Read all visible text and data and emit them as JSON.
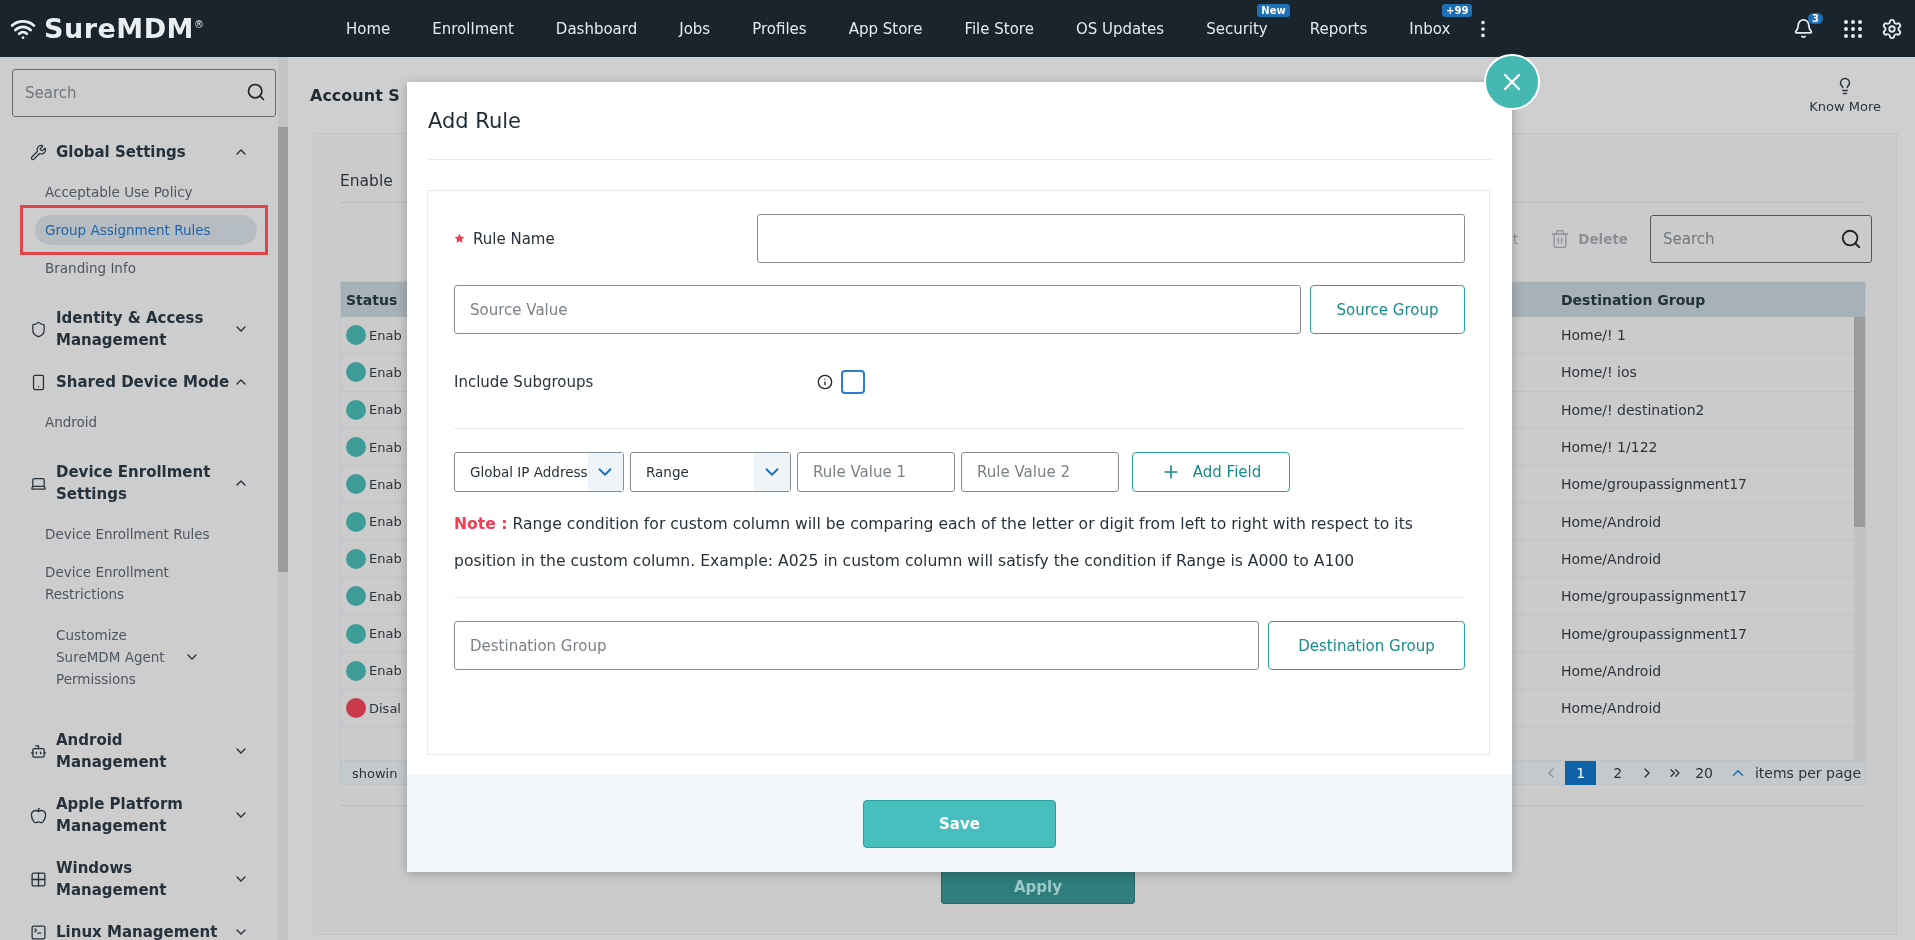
{
  "nav": {
    "logo": "SureMDM",
    "logo_mark": "®",
    "items": [
      {
        "label": "Home"
      },
      {
        "label": "Enrollment"
      },
      {
        "label": "Dashboard"
      },
      {
        "label": "Jobs"
      },
      {
        "label": "Profiles"
      },
      {
        "label": "App Store"
      },
      {
        "label": "File Store"
      },
      {
        "label": "OS Updates"
      },
      {
        "label": "Security",
        "badge": "New"
      },
      {
        "label": "Reports"
      },
      {
        "label": "Inbox",
        "badge": "+99"
      }
    ],
    "notifications_badge": "3"
  },
  "sidebar": {
    "search_placeholder": "Search",
    "sections": [
      {
        "title": "Global Settings",
        "expanded": true,
        "children": [
          {
            "kind": "link",
            "label": "Acceptable Use Policy",
            "selected": false,
            "highlighted": false
          },
          {
            "kind": "link",
            "label": "Group Assignment Rules",
            "selected": true,
            "highlighted": true
          },
          {
            "kind": "link",
            "label": "Branding Info",
            "selected": false,
            "highlighted": false
          }
        ]
      },
      {
        "title": "Identity & Access Management",
        "expanded": false
      },
      {
        "title": "Shared Device Mode",
        "expanded": true,
        "children": [
          {
            "kind": "link",
            "label": "Android",
            "selected": false,
            "highlighted": false
          }
        ]
      },
      {
        "title": "Device Enrollment Settings",
        "expanded": true,
        "children": [
          {
            "kind": "link",
            "label": "Device Enrollment Rules",
            "selected": false,
            "highlighted": false
          },
          {
            "kind": "link",
            "label": "Device Enrollment Restrictions",
            "selected": false,
            "highlighted": false
          },
          {
            "kind": "group",
            "label": "Customize SureMDM Agent Permissions",
            "selected": false,
            "highlighted": false,
            "expanded": false
          }
        ]
      },
      {
        "title": "Android Management",
        "expanded": false
      },
      {
        "title": "Apple Platform Management",
        "expanded": false
      },
      {
        "title": "Windows Management",
        "expanded": false
      },
      {
        "title": "Linux Management",
        "expanded": false
      }
    ]
  },
  "page": {
    "title": "Account S",
    "know_more": "Know More",
    "panel_label": "Enable",
    "toolbar": {
      "action_fragment": "t",
      "delete": "Delete",
      "search_placeholder": "Search"
    },
    "table": {
      "columns": [
        "Status",
        "Destination Group"
      ],
      "rows": [
        {
          "status": "Enab",
          "enabled": true,
          "destination": "Home/! 1"
        },
        {
          "status": "Enab",
          "enabled": true,
          "destination": "Home/! ios"
        },
        {
          "status": "Enab",
          "enabled": true,
          "destination": "Home/! destination2"
        },
        {
          "status": "Enab",
          "enabled": true,
          "destination": "Home/! 1/122"
        },
        {
          "status": "Enab",
          "enabled": true,
          "destination": "Home/groupassignment17"
        },
        {
          "status": "Enab",
          "enabled": true,
          "destination": "Home/Android"
        },
        {
          "status": "Enab",
          "enabled": true,
          "destination": "Home/Android"
        },
        {
          "status": "Enab",
          "enabled": true,
          "destination": "Home/groupassignment17"
        },
        {
          "status": "Enab",
          "enabled": true,
          "destination": "Home/groupassignment17"
        },
        {
          "status": "Enab",
          "enabled": true,
          "destination": "Home/Android"
        },
        {
          "status": "Disal",
          "enabled": false,
          "destination": "Home/Android"
        }
      ]
    },
    "pagination": {
      "info": "showin",
      "pages": [
        {
          "label": "1",
          "selected": true
        },
        {
          "label": "2",
          "selected": false
        }
      ],
      "page_size": "20",
      "page_size_label": "items per page"
    },
    "apply": "Apply"
  },
  "modal": {
    "title": "Add Rule",
    "rule_name_label": "Rule Name",
    "rule_name_required": true,
    "source_placeholder": "Source Value",
    "source_button": "Source Group",
    "include_subgroups_label": "Include Subgroups",
    "include_subgroups_checked": false,
    "condition": {
      "field": "Global IP Address",
      "operator": "Range",
      "value1_placeholder": "Rule Value 1",
      "value2_placeholder": "Rule Value 2",
      "add_button": "Add Field"
    },
    "note_label": "Note :",
    "note_text": "Range condition for custom column will be comparing each of the letter or digit from left to right with respect to its position in the custom column. Example: A025 in custom column will satisfy the condition if Range is A000 to A100",
    "destination_placeholder": "Destination Group",
    "destination_button": "Destination Group",
    "save": "Save"
  }
}
